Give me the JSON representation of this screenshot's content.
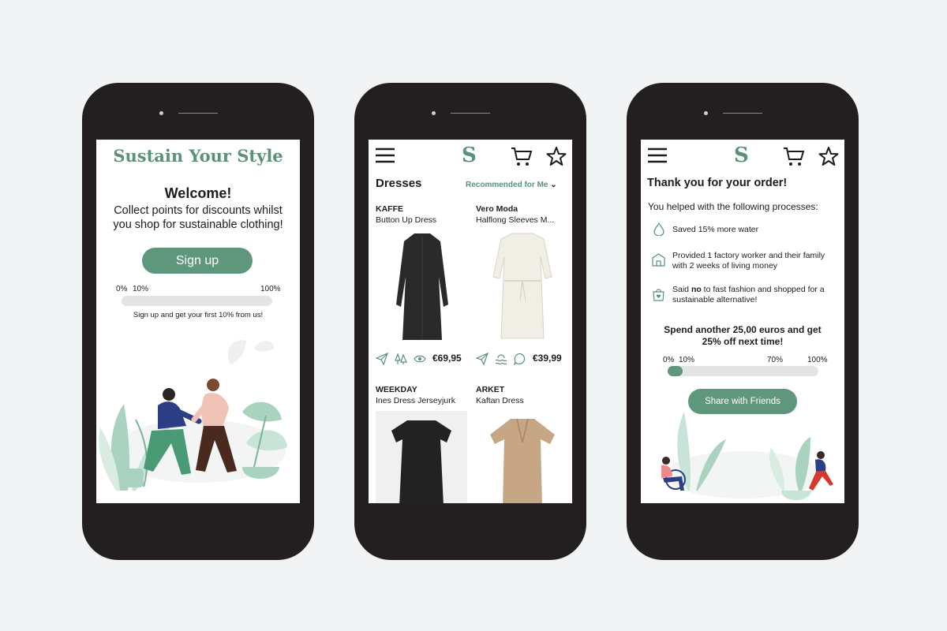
{
  "screen1": {
    "brand": "Sustain Your Style",
    "welcome": "Welcome!",
    "tagline": "Collect points for discounts whilst you shop for sustainable clothing!",
    "signup_button": "Sign up",
    "progress": {
      "start": "0%",
      "current": "10%",
      "end": "100%",
      "fraction": 0.0
    },
    "progress_note": "Sign up and get your first 10% from us!"
  },
  "screen2": {
    "logo": "S",
    "heading": "Dresses",
    "sort_label": "Recommended for Me",
    "products": [
      {
        "brand": "KAFFE",
        "name": "Button Up Dress",
        "price": "€69,95"
      },
      {
        "brand": "Vero Moda",
        "name": "Halflong Sleeves M...",
        "price": "€39,99"
      },
      {
        "brand": "WEEKDAY",
        "name": "Ines Dress Jerseyjurk",
        "price": ""
      },
      {
        "brand": "ARKET",
        "name": "Kaftan Dress",
        "price": ""
      }
    ]
  },
  "screen3": {
    "logo": "S",
    "heading": "Thank you for your order!",
    "intro": "You helped with the following processes:",
    "impacts": [
      {
        "text": "Saved 15% more water",
        "icon": "water-drop-icon"
      },
      {
        "text": "Provided 1 factory worker and their family with 2 weeks of living money",
        "icon": "factory-icon"
      },
      {
        "pre": "Said ",
        "bold": "no",
        "post": " to fast fashion and shopped for a sustainable alternative!",
        "icon": "shopping-bag-icon"
      }
    ],
    "offer": "Spend another 25,00 euros and get 25% off next time!",
    "progress": {
      "start": "0%",
      "current": "10%",
      "mid": "70%",
      "end": "100%",
      "fraction": 0.1
    },
    "share_button": "Share with Friends"
  },
  "colors": {
    "accent": "#5f977c",
    "phone": "#231f20",
    "background": "#f2f3f5"
  }
}
